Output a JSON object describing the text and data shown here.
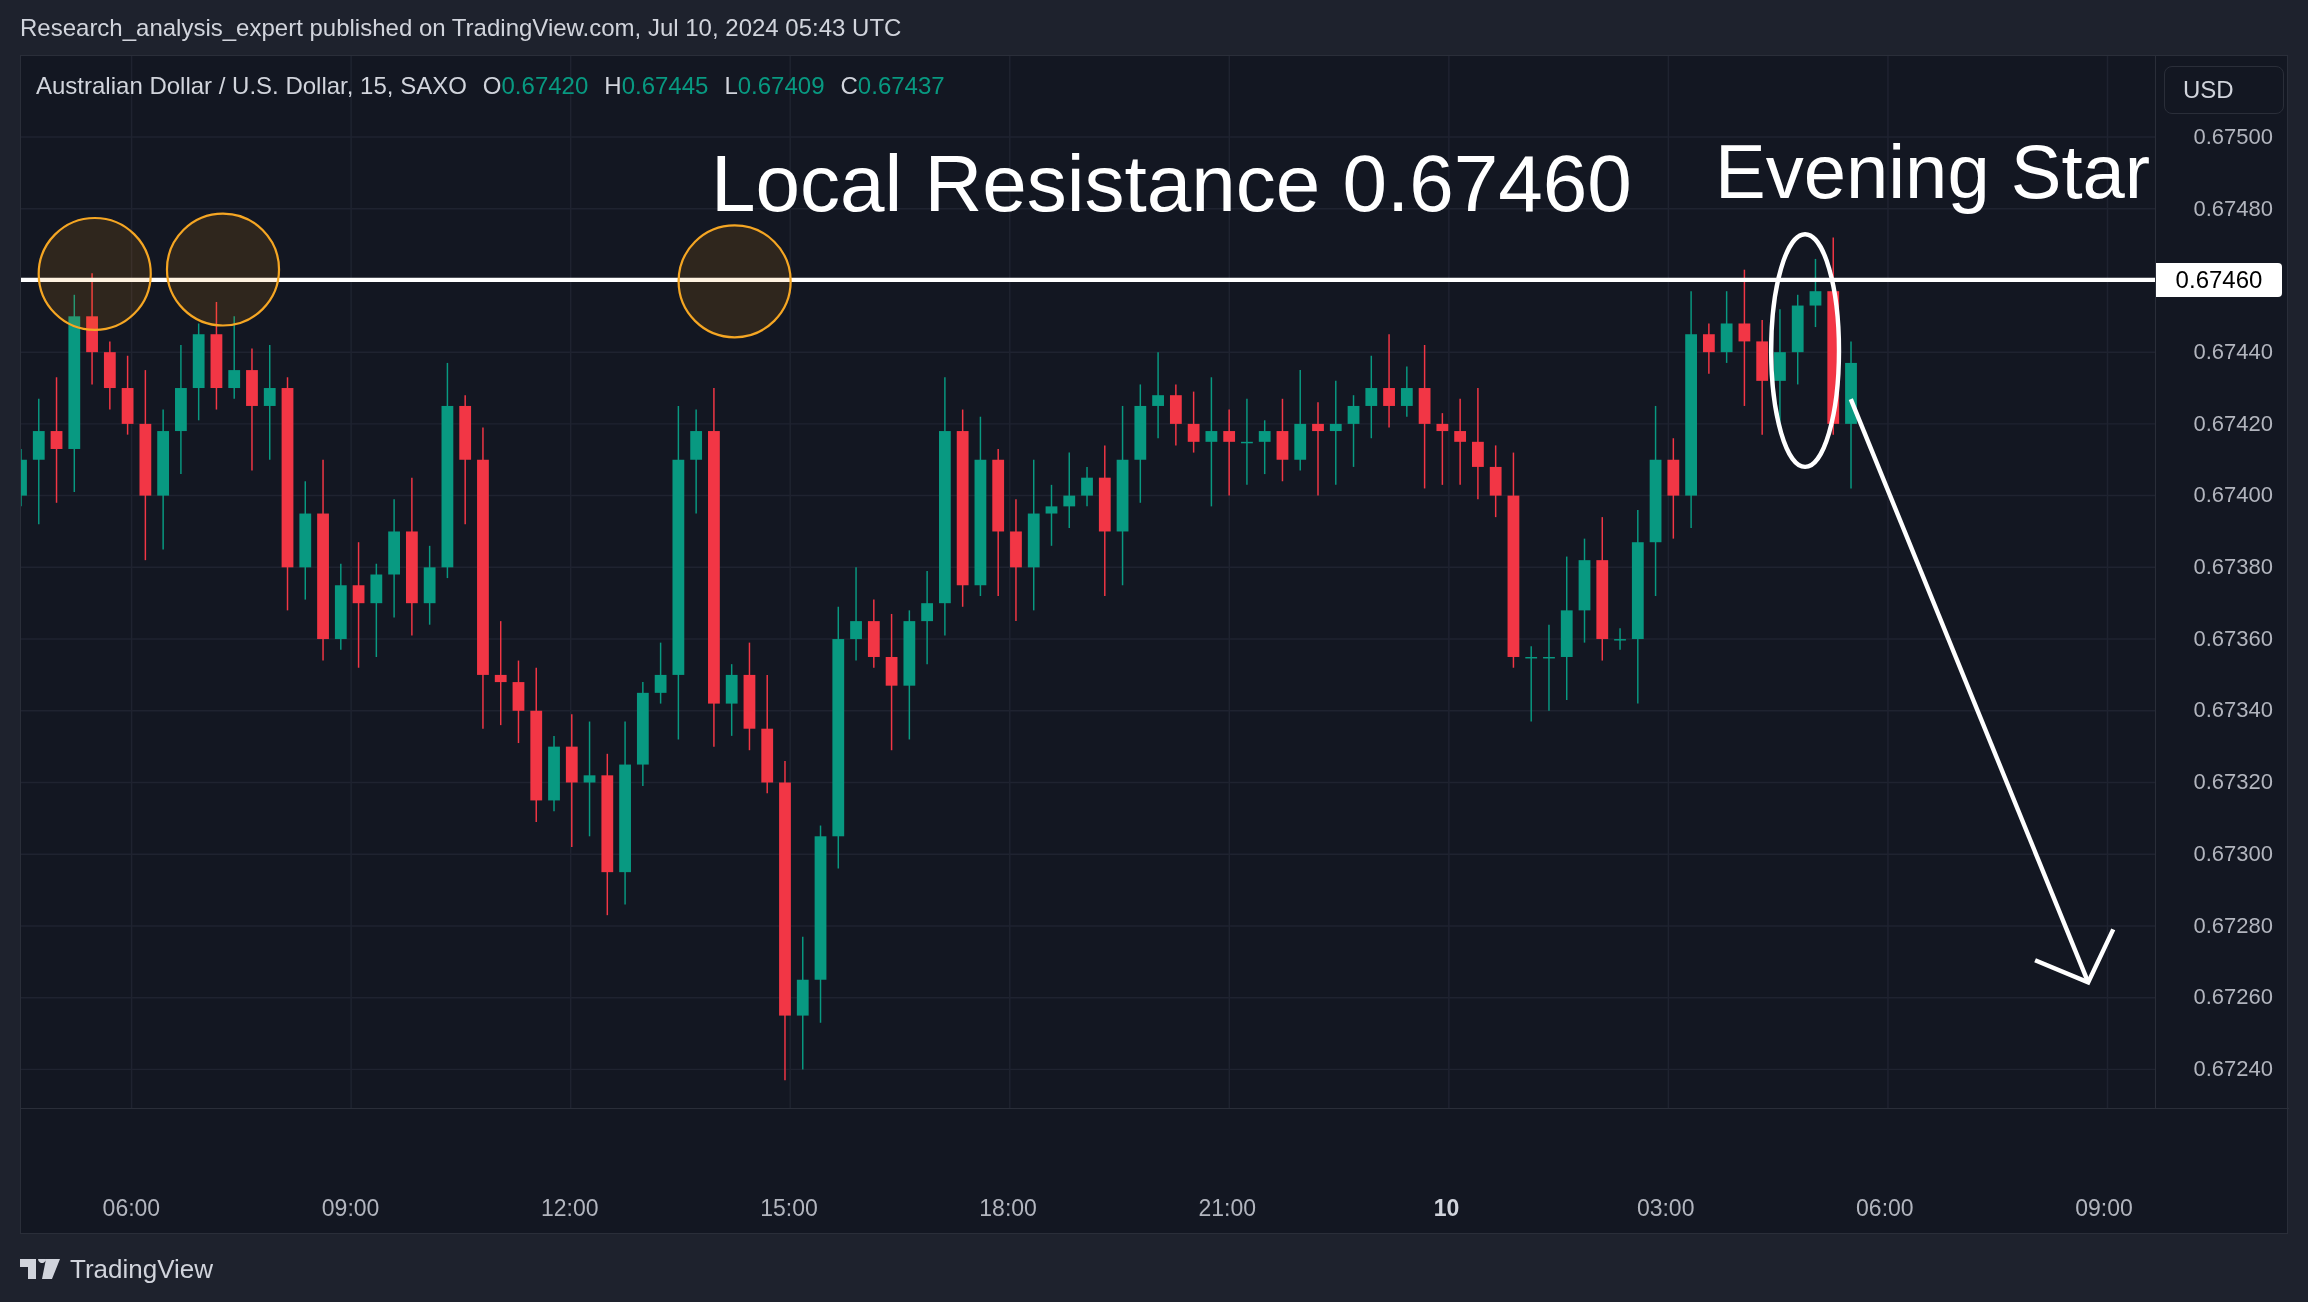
{
  "header": {
    "title": "Research_analysis_expert published on TradingView.com, Jul 10, 2024 05:43 UTC"
  },
  "legend": {
    "symbol": "Australian Dollar / U.S. Dollar, 15, SAXO",
    "values": [
      {
        "label": "O",
        "value": "0.67420"
      },
      {
        "label": "H",
        "value": "0.67445"
      },
      {
        "label": "L",
        "value": "0.67409"
      },
      {
        "label": "C",
        "value": "0.67437"
      }
    ]
  },
  "currency_button": "USD",
  "price_axis": {
    "ticks": [
      "0.67500",
      "0.67480",
      "0.67440",
      "0.67420",
      "0.67400",
      "0.67380",
      "0.67360",
      "0.67340",
      "0.67320",
      "0.67300",
      "0.67280",
      "0.67260",
      "0.67240"
    ]
  },
  "resistance": {
    "price_label": "0.67460"
  },
  "annotations": [
    {
      "kind": "text",
      "text": "Local Resistance 0.67460"
    },
    {
      "kind": "text",
      "text": "Evening Star"
    }
  ],
  "time_axis": {
    "labels": [
      {
        "text": "06:00",
        "bold": false
      },
      {
        "text": "09:00",
        "bold": false
      },
      {
        "text": "12:00",
        "bold": false
      },
      {
        "text": "15:00",
        "bold": false
      },
      {
        "text": "18:00",
        "bold": false
      },
      {
        "text": "21:00",
        "bold": false
      },
      {
        "text": "10",
        "bold": true
      },
      {
        "text": "03:00",
        "bold": false
      },
      {
        "text": "06:00",
        "bold": false
      },
      {
        "text": "09:00",
        "bold": false
      }
    ]
  },
  "footer": {
    "brand": "TradingView"
  }
}
